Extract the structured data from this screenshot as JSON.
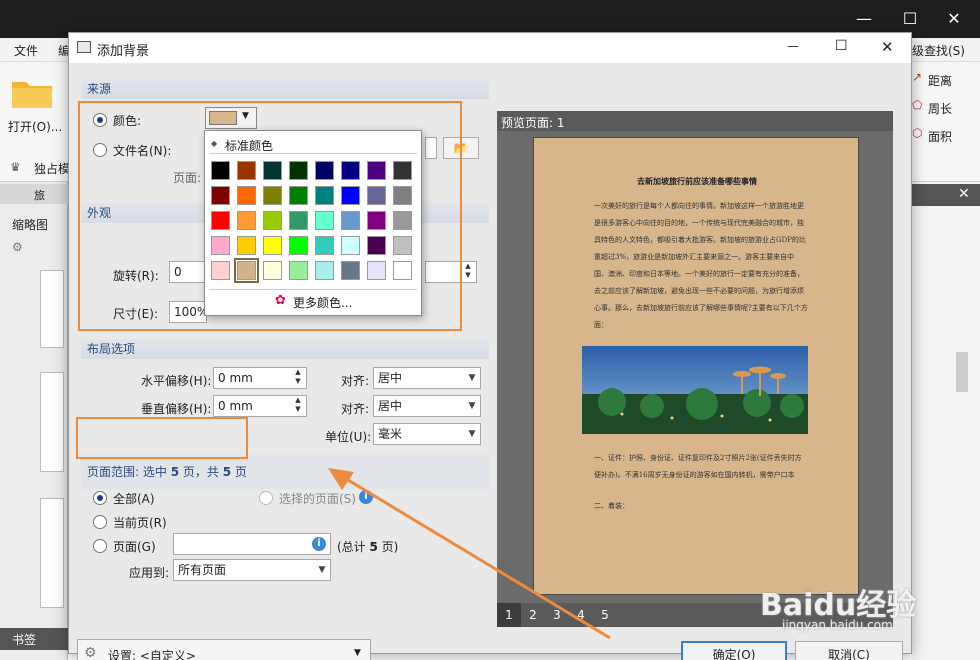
{
  "app": {
    "menu": {
      "file": "文件",
      "edit": "编",
      "adv_find": "级查找(S)"
    },
    "ribbon": {
      "open": "打开(O)...",
      "exclusive": "独占模",
      "distance": "距离",
      "perimeter": "周长",
      "area": "面积",
      "tab_label": "旅"
    },
    "left_panel": {
      "title": "缩略图",
      "bookmarks": "书签"
    },
    "window_controls": {
      "minimize": "—",
      "maximize": "☐",
      "close": "✕"
    }
  },
  "dialog": {
    "title": "添加背景",
    "controls": {
      "minimize": "—",
      "maximize": "☐",
      "close": "✕"
    },
    "source": {
      "header": "来源",
      "color_label": "颜色:",
      "filename_label": "文件名(N):",
      "page_label": "页面:",
      "selected_color": "#d6b68a"
    },
    "color_popup": {
      "header": "标准颜色",
      "more": "更多颜色...",
      "swatches": [
        [
          "#000000",
          "#993300",
          "#003333",
          "#003300",
          "#000066",
          "#000080",
          "#4b0082",
          "#333333"
        ],
        [
          "#800000",
          "#ff6600",
          "#808000",
          "#008000",
          "#008080",
          "#0000ff",
          "#666699",
          "#808080"
        ],
        [
          "#ff0000",
          "#ff9933",
          "#99cc00",
          "#339966",
          "#66ffcc",
          "#6699cc",
          "#800080",
          "#999999"
        ],
        [
          "#ffaacc",
          "#ffcc00",
          "#ffff00",
          "#00ff00",
          "#33ccbb",
          "#ccffff",
          "#4b0050",
          "#c0c0c0"
        ],
        [
          "#ffd0d0",
          "#d2b48c",
          "#ffffdd",
          "#99ee99",
          "#aaeeee",
          "#667788",
          "#e6e6fa",
          "#ffffff"
        ]
      ],
      "selected_index": [
        4,
        1
      ]
    },
    "appearance": {
      "header": "外观",
      "rotate_label": "旋转(R):",
      "rotate_value": "0",
      "size_label": "尺寸(E):",
      "size_value": "100%"
    },
    "layout": {
      "header": "布局选项",
      "h_offset_label": "水平偏移(H):",
      "h_offset_value": "0 mm",
      "v_offset_label": "垂直偏移(H):",
      "v_offset_value": "0 mm",
      "align_label": "对齐:",
      "align_h_value": "居中",
      "align_v_value": "居中",
      "unit_label": "单位(U):",
      "unit_value": "毫米"
    },
    "page_range": {
      "summary_prefix": "页面范围: 选中 ",
      "selected": "5",
      "summary_mid": " 页，共 ",
      "total": "5",
      "summary_suffix": " 页",
      "all": "全部(A)",
      "selected_pages": "选择的页面(S)",
      "current": "当前页(R)",
      "pages": "页面(G)",
      "total_prefix": "(总计 ",
      "total_count": "5",
      "total_suffix": " 页)",
      "apply_label": "应用到:",
      "apply_value": "所有页面"
    },
    "preview": {
      "header": "预览页面: 1",
      "pages": [
        "1",
        "2",
        "3",
        "4",
        "5"
      ],
      "doc_title": "去新加坡旅行前应该准备哪些事情",
      "para1": "一次美好的旅行是每个人都向往的事情。新加坡这样一个旅游胜地更是很多游客心中向往的目的地，一个传统与现代完美融合的城市，独具特色的人文特色，都吸引着大批游客。新加坡的旅游业占GDP的比重超过3%，旅游业是新加坡外汇主要来源之一。游客主要来自中国、澳洲、印度和日本等地。一个美好的旅行一定要有充分的准备，去之前应该了解新加坡，避免出现一些不必要的问题，为旅行增添烦心事。那么，去新加坡旅行前应该了解哪些事情呢?主要有以下几个方面：",
      "para2": "一、证件：护照、身份证、证件复印件及2寸照片2张(证件丢失时方便补办)。不满16周岁无身份证的游客如在国内转机，需带户口本",
      "para3": "二、着装："
    },
    "footer": {
      "settings_label": "设置: <自定义>",
      "ok": "确定(O)",
      "cancel": "取消(C)"
    }
  },
  "watermark": {
    "text": "Baidu经验",
    "sub": "jingyan.baidu.com"
  }
}
